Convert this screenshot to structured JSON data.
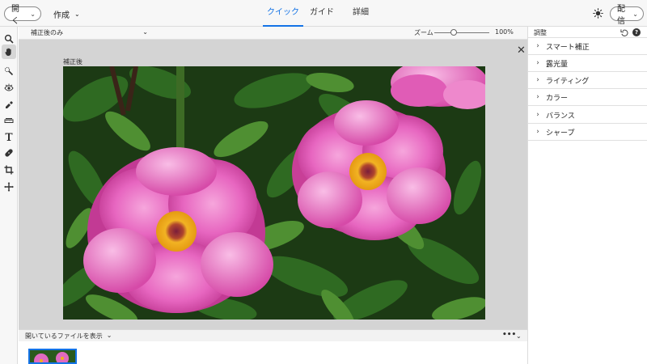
{
  "header": {
    "open_label": "開く",
    "create_label": "作成",
    "share_label": "配信",
    "tabs": [
      {
        "label": "クイック",
        "active": true
      },
      {
        "label": "ガイド",
        "active": false
      },
      {
        "label": "詳細",
        "active": false
      }
    ],
    "accent_color": "#1473e6"
  },
  "toolbar": {
    "tools": [
      {
        "icon": "zoom-icon"
      },
      {
        "icon": "hand-icon",
        "active": true
      },
      {
        "icon": "quick-selection-icon"
      },
      {
        "icon": "red-eye-icon"
      },
      {
        "icon": "whiten-teeth-icon"
      },
      {
        "icon": "straighten-icon"
      },
      {
        "icon": "text-icon"
      },
      {
        "icon": "spot-healing-icon"
      },
      {
        "icon": "crop-icon"
      },
      {
        "icon": "move-icon"
      }
    ]
  },
  "options_bar": {
    "view_mode": "補正後のみ",
    "zoom_label": "ズーム",
    "zoom_value": "100%",
    "zoom_fraction": 0.35
  },
  "canvas": {
    "label": "補正後"
  },
  "photo_bin": {
    "label": "開いているファイルを表示",
    "more_label": "•••"
  },
  "panel": {
    "title": "調整",
    "sections": [
      {
        "label": "スマート補正"
      },
      {
        "label": "露光量"
      },
      {
        "label": "ライティング"
      },
      {
        "label": "カラー"
      },
      {
        "label": "バランス"
      },
      {
        "label": "シャープ"
      }
    ]
  }
}
